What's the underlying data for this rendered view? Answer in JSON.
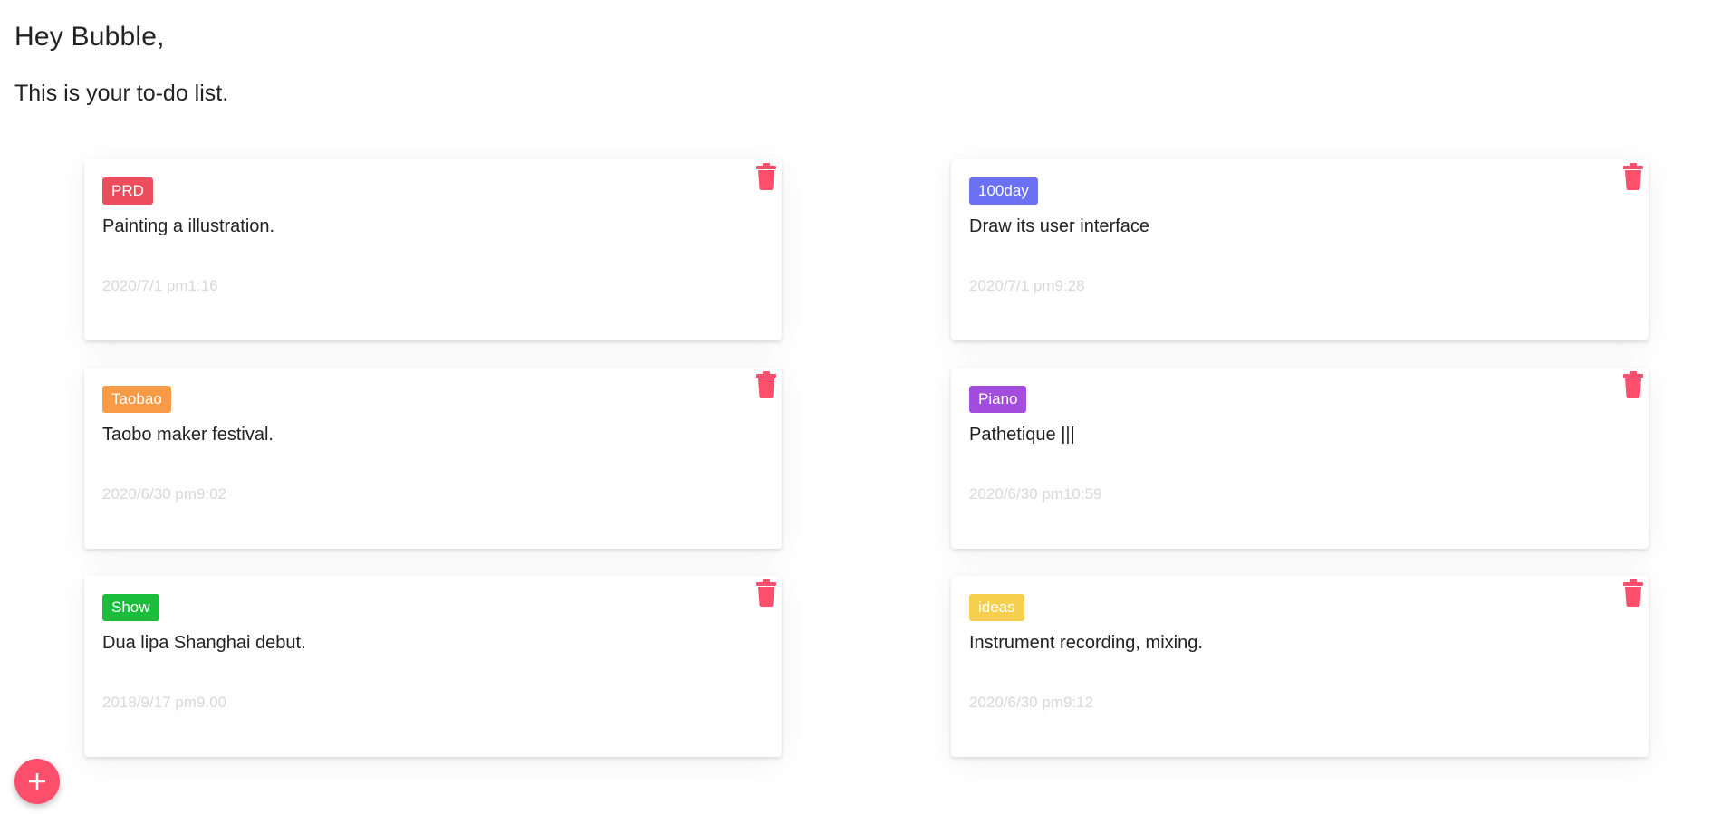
{
  "header": {
    "greeting": "Hey Bubble,",
    "subtitle": "This is your to-do list."
  },
  "colors": {
    "delete_icon": "#fd4e6c",
    "fab": "#fd4e6c",
    "timestamp": "#d8d8d8"
  },
  "cards": [
    {
      "tag": "PRD",
      "tag_color": "#ee4d5d",
      "task": "Painting a illustration.",
      "time": "2020/7/1 pm1:16"
    },
    {
      "tag": "100day",
      "tag_color": "#6a71f3",
      "task": "Draw its user interface",
      "time": "2020/7/1 pm9:28"
    },
    {
      "tag": "Taobao",
      "tag_color": "#f89a46",
      "task": "Taobo maker festival.",
      "time": "2020/6/30 pm9:02"
    },
    {
      "tag": "Piano",
      "tag_color": "#a24ddd",
      "task": "Pathetique |||",
      "time": "2020/6/30 pm10:59"
    },
    {
      "tag": "Show",
      "tag_color": "#1bbd3d",
      "task": "Dua lipa Shanghai debut.",
      "time": "2018/9/17 pm9.00"
    },
    {
      "tag": "ideas",
      "tag_color": "#f6cf4f",
      "task": "Instrument recording, mixing.",
      "time": "2020/6/30 pm9:12"
    }
  ],
  "icons": {
    "delete": "trash-icon",
    "add": "plus-icon"
  }
}
